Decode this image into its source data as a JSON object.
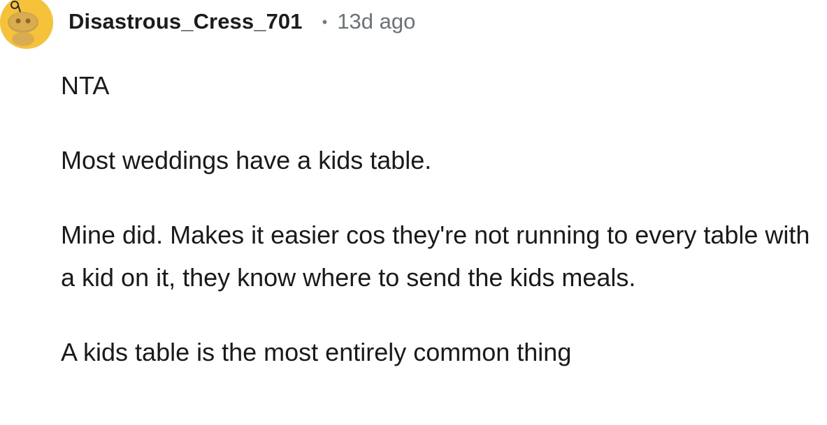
{
  "comment": {
    "username": "Disastrous_Cress_701",
    "separator": "•",
    "timestamp": "13d ago",
    "avatar_icon": "snoo-avatar-icon",
    "avatar_color": "#F6C23A",
    "paragraphs": [
      "NTA",
      "Most weddings have a kids table.",
      "Mine did. Makes it easier cos they're not running to every table with a kid on it, they know where to send the kids meals.",
      "A kids table is the most entirely common thing"
    ]
  }
}
